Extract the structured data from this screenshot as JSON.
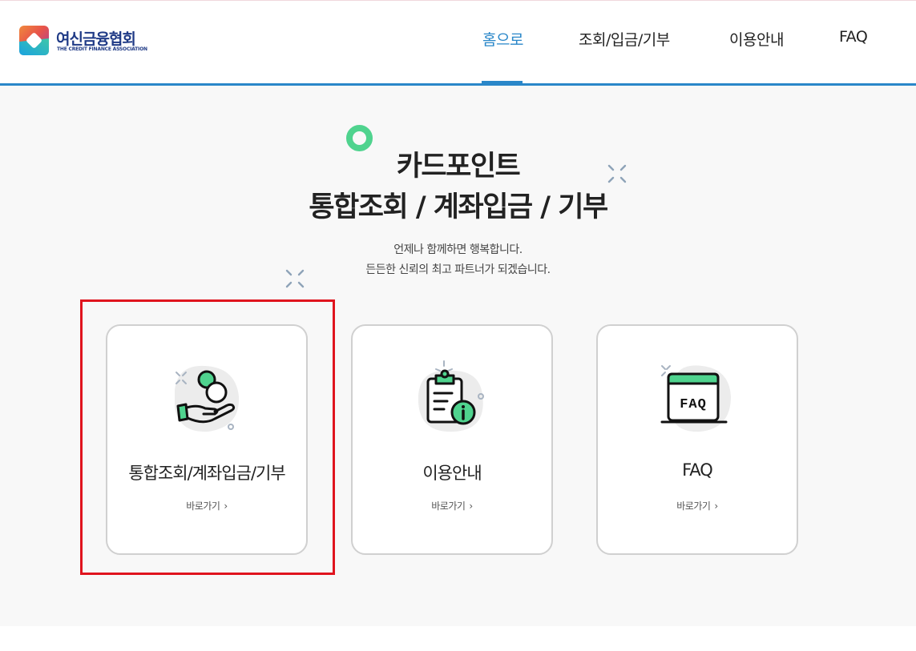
{
  "colors": {
    "accent": "#2a87c9",
    "brand_navy": "#1f3a86",
    "green": "#4fd38e",
    "highlight": "#e0141e"
  },
  "logo": {
    "name": "여신금융협회",
    "subtitle": "THE CREDIT FINANCE ASSOCIATION"
  },
  "nav": {
    "items": [
      {
        "label": "홈으로",
        "active": true
      },
      {
        "label": "조회/입금/기부",
        "active": false
      },
      {
        "label": "이용안내",
        "active": false
      },
      {
        "label": "FAQ",
        "active": false
      }
    ]
  },
  "hero": {
    "title_line1": "카드포인트",
    "title_line2": "통합조회 / 계좌입금 / 기부",
    "sub_line1": "언제나 함께하면 행복합니다.",
    "sub_line2": "든든한 신뢰의 최고 파트너가 되겠습니다."
  },
  "cards": [
    {
      "title": "통합조회/계좌입금/기부",
      "link": "바로가기",
      "icon": "hand-coins-icon"
    },
    {
      "title": "이용안내",
      "link": "바로가기",
      "icon": "clipboard-info-icon"
    },
    {
      "title": "FAQ",
      "link": "바로가기",
      "icon": "faq-window-icon"
    }
  ]
}
